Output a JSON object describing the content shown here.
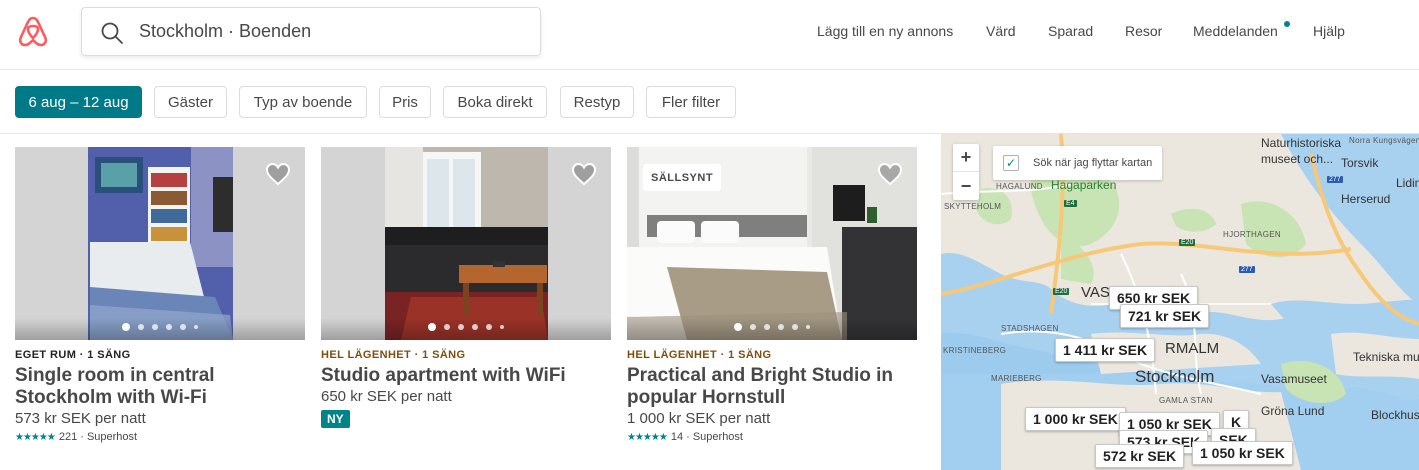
{
  "header": {
    "search_text": "Stockholm · Boenden",
    "nav": {
      "add_listing": "Lägg till en ny annons",
      "host": "Värd",
      "saved": "Sparad",
      "trips": "Resor",
      "messages": "Meddelanden",
      "help": "Hjälp"
    }
  },
  "filters": {
    "dates": "6 aug – 12 aug",
    "guests": "Gäster",
    "room_type": "Typ av boende",
    "price": "Pris",
    "instant_book": "Boka direkt",
    "trip_type": "Restyp",
    "more_filters": "Fler filter"
  },
  "listings": [
    {
      "type": "EGET RUM · 1 SÄNG",
      "title": "Single room in central Stockholm with Wi-Fi",
      "price": "573 kr SEK",
      "per": "per natt",
      "stars": "★★★★★",
      "reviews": "221 · Superhost"
    },
    {
      "type": "HEL LÄGENHET · 1 SÄNG",
      "title": "Studio apartment with WiFi",
      "price": "650 kr SEK",
      "per": "per natt",
      "new_badge": "NY"
    },
    {
      "badge": "SÄLLSYNT",
      "type": "HEL LÄGENHET · 1 SÄNG",
      "title": "Practical and Bright Studio in popular Hornstull",
      "price": "1 000 kr SEK",
      "per": "per natt",
      "stars": "★★★★★",
      "reviews": "14 · Superhost"
    }
  ],
  "map": {
    "zoom_in": "+",
    "zoom_out": "−",
    "search_on_move": "Sök när jag flyttar kartan",
    "labels": {
      "naturhistoriska": "Naturhistoriska",
      "museet": "museet och...",
      "hagaparken": "Hagaparken",
      "hagalund": "HAGALUND",
      "skytteholm": "SKYTTEHOLM",
      "torsvik": "Torsvik",
      "herserud": "Herserud",
      "hjorthagen": "HJORTHAGEN",
      "vasa": "VAS",
      "stadshagen": "STADSHAGEN",
      "kristineberg": "KRISTINEBERG",
      "marieberg": "MARIEBERG",
      "normalm": "RMALM",
      "stockholm": "Stockholm",
      "vasamuseet": "Vasamuseet",
      "tekniska": "Tekniska mu",
      "grona_lund": "Gröna Lund",
      "gamla_stan": "GAMLA STAN",
      "blockhus": "Blockhus",
      "lidin": "Lidin",
      "norra_kungsvagen": "Norra Kungsvägen",
      "e4": "E4",
      "e20a": "E20",
      "e20b": "E20",
      "r277a": "277",
      "r277b": "277"
    },
    "pins": [
      "650 kr SEK",
      "721 kr SEK",
      "1 411 kr SEK",
      "1 000 kr SEK",
      "1 050 kr SEK",
      "573 kr SEK",
      "K",
      "SEK",
      "572 kr SEK",
      "1 050 kr SEK"
    ]
  },
  "colors": {
    "brand": "#FF5A5F",
    "teal": "#008489",
    "active_chip": "#007A87",
    "gold_type": "#7B4F0E"
  },
  "icons": {
    "logo": "airbnb-logo-icon",
    "search": "search-icon",
    "heart": "heart-icon",
    "checkbox": "checkbox-icon"
  }
}
